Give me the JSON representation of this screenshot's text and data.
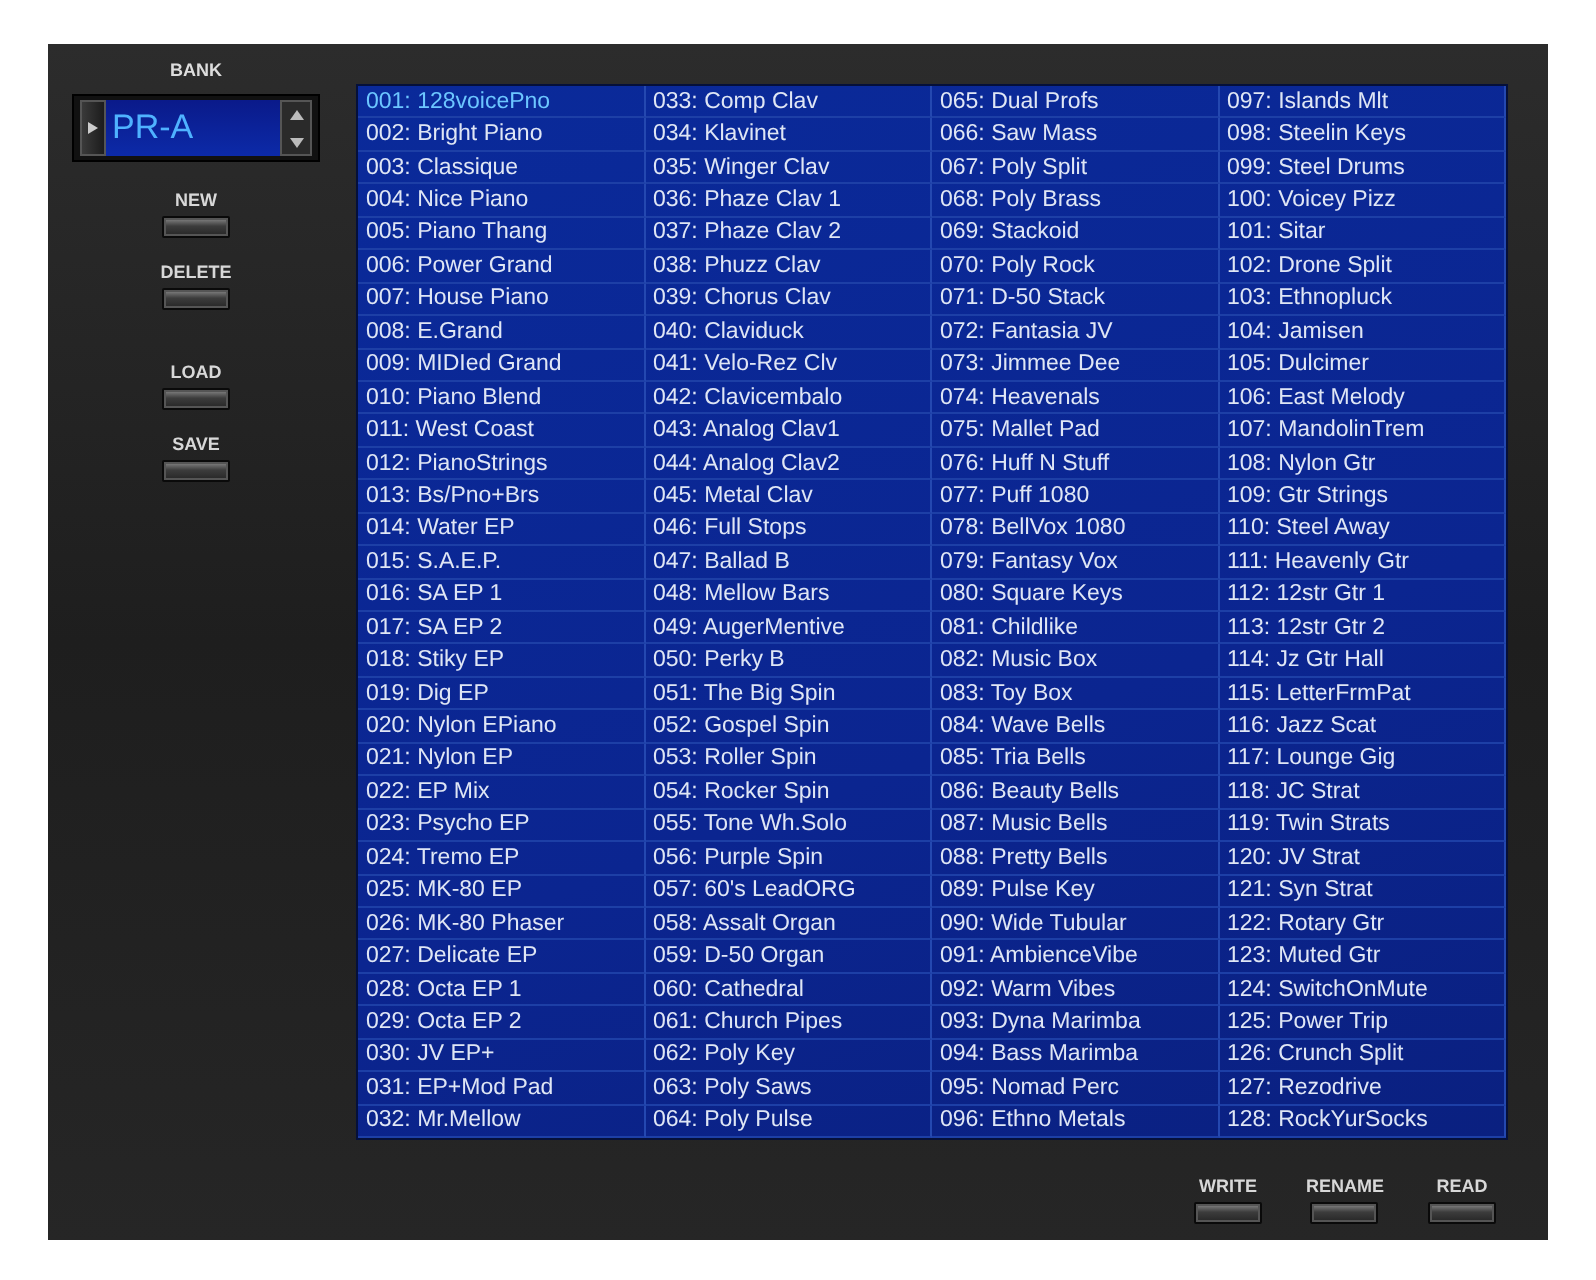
{
  "bank": {
    "label": "BANK",
    "value": "PR-A"
  },
  "side_buttons": [
    {
      "label": "NEW"
    },
    {
      "label": "DELETE"
    },
    {
      "label": "LOAD"
    },
    {
      "label": "SAVE"
    }
  ],
  "patches": [
    {
      "label": "001: 128voicePno",
      "selected": true
    },
    {
      "label": "002: Bright Piano",
      "selected": false
    },
    {
      "label": "003: Classique",
      "selected": false
    },
    {
      "label": "004: Nice Piano",
      "selected": false
    },
    {
      "label": "005: Piano Thang",
      "selected": false
    },
    {
      "label": "006: Power Grand",
      "selected": false
    },
    {
      "label": "007: House Piano",
      "selected": false
    },
    {
      "label": "008: E.Grand",
      "selected": false
    },
    {
      "label": "009: MIDIed Grand",
      "selected": false
    },
    {
      "label": "010: Piano Blend",
      "selected": false
    },
    {
      "label": "011: West Coast",
      "selected": false
    },
    {
      "label": "012: PianoStrings",
      "selected": false
    },
    {
      "label": "013: Bs/Pno+Brs",
      "selected": false
    },
    {
      "label": "014: Water EP",
      "selected": false
    },
    {
      "label": "015: S.A.E.P.",
      "selected": false
    },
    {
      "label": "016: SA EP 1",
      "selected": false
    },
    {
      "label": "017: SA EP 2",
      "selected": false
    },
    {
      "label": "018: Stiky EP",
      "selected": false
    },
    {
      "label": "019: Dig EP",
      "selected": false
    },
    {
      "label": "020: Nylon EPiano",
      "selected": false
    },
    {
      "label": "021: Nylon EP",
      "selected": false
    },
    {
      "label": "022: EP Mix",
      "selected": false
    },
    {
      "label": "023: Psycho EP",
      "selected": false
    },
    {
      "label": "024: Tremo EP",
      "selected": false
    },
    {
      "label": "025: MK-80 EP",
      "selected": false
    },
    {
      "label": "026: MK-80 Phaser",
      "selected": false
    },
    {
      "label": "027: Delicate EP",
      "selected": false
    },
    {
      "label": "028: Octa EP 1",
      "selected": false
    },
    {
      "label": "029: Octa EP 2",
      "selected": false
    },
    {
      "label": "030: JV EP+",
      "selected": false
    },
    {
      "label": "031: EP+Mod Pad",
      "selected": false
    },
    {
      "label": "032: Mr.Mellow",
      "selected": false
    },
    {
      "label": "033: Comp Clav",
      "selected": false
    },
    {
      "label": "034: Klavinet",
      "selected": false
    },
    {
      "label": "035: Winger Clav",
      "selected": false
    },
    {
      "label": "036: Phaze Clav 1",
      "selected": false
    },
    {
      "label": "037: Phaze Clav 2",
      "selected": false
    },
    {
      "label": "038: Phuzz Clav",
      "selected": false
    },
    {
      "label": "039: Chorus Clav",
      "selected": false
    },
    {
      "label": "040: Claviduck",
      "selected": false
    },
    {
      "label": "041: Velo-Rez Clv",
      "selected": false
    },
    {
      "label": "042: Clavicembalo",
      "selected": false
    },
    {
      "label": "043: Analog Clav1",
      "selected": false
    },
    {
      "label": "044: Analog Clav2",
      "selected": false
    },
    {
      "label": "045: Metal Clav",
      "selected": false
    },
    {
      "label": "046: Full Stops",
      "selected": false
    },
    {
      "label": "047: Ballad B",
      "selected": false
    },
    {
      "label": "048: Mellow Bars",
      "selected": false
    },
    {
      "label": "049: AugerMentive",
      "selected": false
    },
    {
      "label": "050: Perky B",
      "selected": false
    },
    {
      "label": "051: The Big Spin",
      "selected": false
    },
    {
      "label": "052: Gospel Spin",
      "selected": false
    },
    {
      "label": "053: Roller Spin",
      "selected": false
    },
    {
      "label": "054: Rocker Spin",
      "selected": false
    },
    {
      "label": "055: Tone Wh.Solo",
      "selected": false
    },
    {
      "label": "056: Purple Spin",
      "selected": false
    },
    {
      "label": "057: 60's LeadORG",
      "selected": false
    },
    {
      "label": "058: Assalt Organ",
      "selected": false
    },
    {
      "label": "059: D-50 Organ",
      "selected": false
    },
    {
      "label": "060: Cathedral",
      "selected": false
    },
    {
      "label": "061: Church Pipes",
      "selected": false
    },
    {
      "label": "062: Poly Key",
      "selected": false
    },
    {
      "label": "063: Poly Saws",
      "selected": false
    },
    {
      "label": "064: Poly Pulse",
      "selected": false
    },
    {
      "label": "065: Dual Profs",
      "selected": false
    },
    {
      "label": "066: Saw Mass",
      "selected": false
    },
    {
      "label": "067: Poly Split",
      "selected": false
    },
    {
      "label": "068: Poly Brass",
      "selected": false
    },
    {
      "label": "069: Stackoid",
      "selected": false
    },
    {
      "label": "070: Poly Rock",
      "selected": false
    },
    {
      "label": "071: D-50 Stack",
      "selected": false
    },
    {
      "label": "072: Fantasia JV",
      "selected": false
    },
    {
      "label": "073: Jimmee Dee",
      "selected": false
    },
    {
      "label": "074: Heavenals",
      "selected": false
    },
    {
      "label": "075: Mallet Pad",
      "selected": false
    },
    {
      "label": "076: Huff N Stuff",
      "selected": false
    },
    {
      "label": "077: Puff 1080",
      "selected": false
    },
    {
      "label": "078: BellVox 1080",
      "selected": false
    },
    {
      "label": "079: Fantasy Vox",
      "selected": false
    },
    {
      "label": "080: Square Keys",
      "selected": false
    },
    {
      "label": "081: Childlike",
      "selected": false
    },
    {
      "label": "082: Music Box",
      "selected": false
    },
    {
      "label": "083: Toy Box",
      "selected": false
    },
    {
      "label": "084: Wave Bells",
      "selected": false
    },
    {
      "label": "085: Tria Bells",
      "selected": false
    },
    {
      "label": "086: Beauty Bells",
      "selected": false
    },
    {
      "label": "087: Music Bells",
      "selected": false
    },
    {
      "label": "088: Pretty Bells",
      "selected": false
    },
    {
      "label": "089: Pulse Key",
      "selected": false
    },
    {
      "label": "090: Wide Tubular",
      "selected": false
    },
    {
      "label": "091: AmbienceVibe",
      "selected": false
    },
    {
      "label": "092: Warm Vibes",
      "selected": false
    },
    {
      "label": "093: Dyna Marimba",
      "selected": false
    },
    {
      "label": "094: Bass Marimba",
      "selected": false
    },
    {
      "label": "095: Nomad Perc",
      "selected": false
    },
    {
      "label": "096: Ethno Metals",
      "selected": false
    },
    {
      "label": "097: Islands Mlt",
      "selected": false
    },
    {
      "label": "098: Steelin Keys",
      "selected": false
    },
    {
      "label": "099: Steel Drums",
      "selected": false
    },
    {
      "label": "100: Voicey Pizz",
      "selected": false
    },
    {
      "label": "101: Sitar",
      "selected": false
    },
    {
      "label": "102: Drone Split",
      "selected": false
    },
    {
      "label": "103: Ethnopluck",
      "selected": false
    },
    {
      "label": "104: Jamisen",
      "selected": false
    },
    {
      "label": "105: Dulcimer",
      "selected": false
    },
    {
      "label": "106: East Melody",
      "selected": false
    },
    {
      "label": "107: MandolinTrem",
      "selected": false
    },
    {
      "label": "108: Nylon Gtr",
      "selected": false
    },
    {
      "label": "109: Gtr Strings",
      "selected": false
    },
    {
      "label": "110: Steel Away",
      "selected": false
    },
    {
      "label": "111: Heavenly Gtr",
      "selected": false
    },
    {
      "label": "112: 12str Gtr 1",
      "selected": false
    },
    {
      "label": "113: 12str Gtr 2",
      "selected": false
    },
    {
      "label": "114: Jz Gtr Hall",
      "selected": false
    },
    {
      "label": "115: LetterFrmPat",
      "selected": false
    },
    {
      "label": "116: Jazz Scat",
      "selected": false
    },
    {
      "label": "117: Lounge Gig",
      "selected": false
    },
    {
      "label": "118: JC Strat",
      "selected": false
    },
    {
      "label": "119: Twin Strats",
      "selected": false
    },
    {
      "label": "120: JV Strat",
      "selected": false
    },
    {
      "label": "121: Syn Strat",
      "selected": false
    },
    {
      "label": "122: Rotary Gtr",
      "selected": false
    },
    {
      "label": "123: Muted Gtr",
      "selected": false
    },
    {
      "label": "124: SwitchOnMute",
      "selected": false
    },
    {
      "label": "125: Power Trip",
      "selected": false
    },
    {
      "label": "126: Crunch Split",
      "selected": false
    },
    {
      "label": "127: Rezodrive",
      "selected": false
    },
    {
      "label": "128: RockYurSocks",
      "selected": false
    }
  ],
  "bottom_buttons": [
    {
      "label": "WRITE"
    },
    {
      "label": "RENAME"
    },
    {
      "label": "READ"
    }
  ]
}
